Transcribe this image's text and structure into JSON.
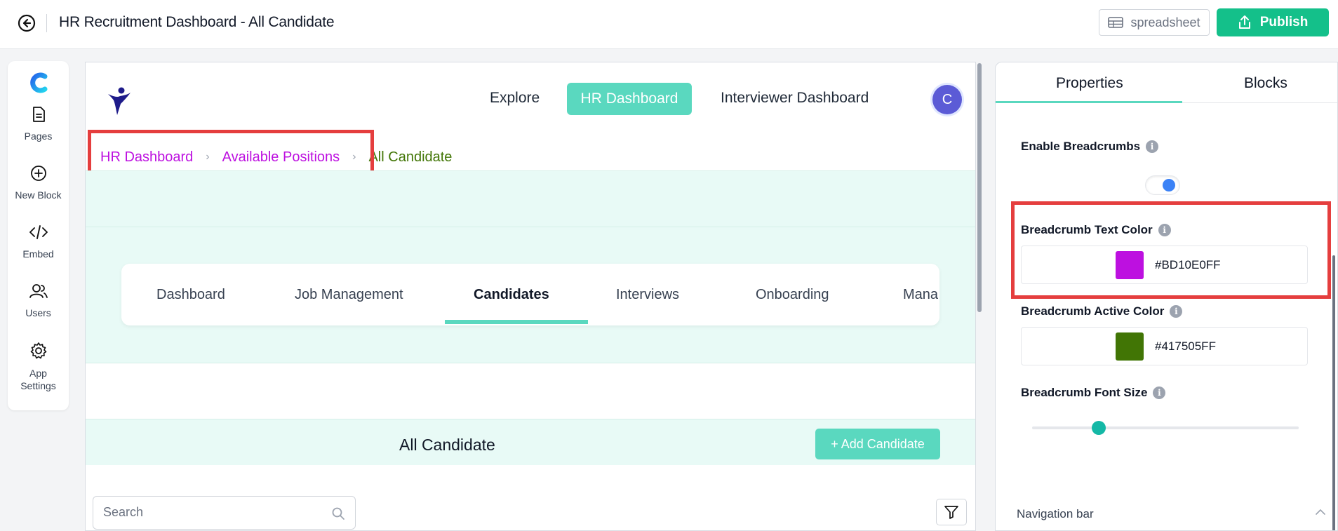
{
  "header": {
    "title": "HR Recruitment Dashboard - All Candidate",
    "spreadsheet_label": "spreadsheet",
    "publish_label": "Publish"
  },
  "sidebar": {
    "items": [
      {
        "label": "Pages",
        "icon": "document-icon"
      },
      {
        "label": "New Block",
        "icon": "plus-circle-icon"
      },
      {
        "label": "Embed",
        "icon": "code-icon"
      },
      {
        "label": "Users",
        "icon": "users-icon"
      },
      {
        "label": "App Settings",
        "icon": "gear-icon"
      }
    ]
  },
  "canvas": {
    "nav": {
      "explore": "Explore",
      "hr_dashboard": "HR Dashboard",
      "interviewer_dashboard": "Interviewer Dashboard",
      "avatar_letter": "C"
    },
    "breadcrumb": {
      "items": [
        "HR Dashboard",
        "Available Positions"
      ],
      "active": "All Candidate",
      "separator": "›"
    },
    "tabs": [
      {
        "label": "Dashboard"
      },
      {
        "label": "Job Management"
      },
      {
        "label": "Candidates",
        "active": true
      },
      {
        "label": "Interviews"
      },
      {
        "label": "Onboarding"
      },
      {
        "label": "Mana"
      }
    ],
    "section_title": "All Candidate",
    "add_button": "+ Add Candidate",
    "search_placeholder": "Search"
  },
  "properties_panel": {
    "tabs": [
      "Properties",
      "Blocks"
    ],
    "active_tab": "Properties",
    "enable_breadcrumbs_label": "Enable Breadcrumbs",
    "enable_breadcrumbs": true,
    "text_color_label": "Breadcrumb Text Color",
    "text_color": "#BD10E0FF",
    "active_color_label": "Breadcrumb Active Color",
    "active_color": "#417505FF",
    "font_size_label": "Breadcrumb Font Size",
    "navigation_bar_label": "Navigation bar"
  },
  "colors": {
    "accent_teal": "#5ad8bf",
    "publish_green": "#14c08a",
    "breadcrumb_text": "#BD10E0",
    "breadcrumb_active": "#417505",
    "highlight_red": "#e53e3e"
  }
}
